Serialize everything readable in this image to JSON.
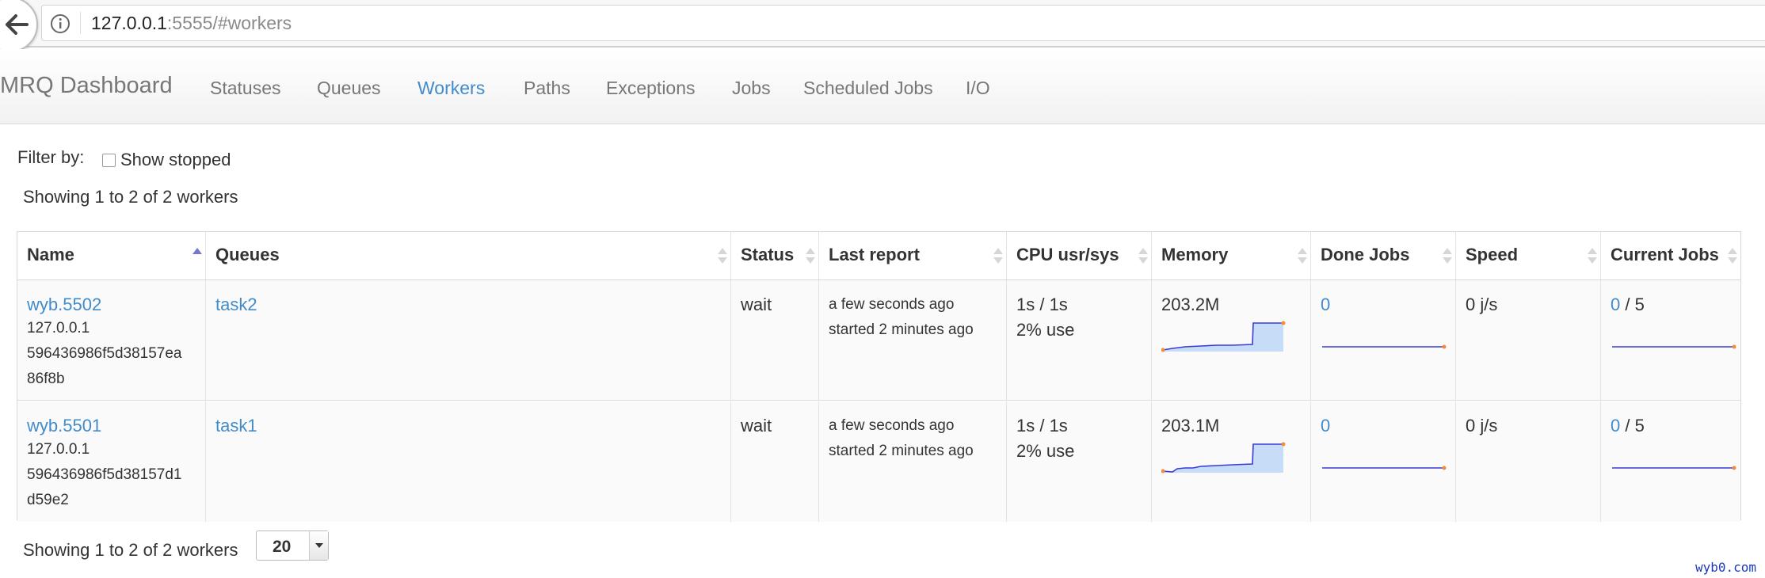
{
  "browser": {
    "url_host": "127.0.0.1",
    "url_rest": ":5555/#workers"
  },
  "navbar": {
    "brand": "MRQ Dashboard",
    "items": [
      "Statuses",
      "Queues",
      "Workers",
      "Paths",
      "Exceptions",
      "Jobs",
      "Scheduled Jobs",
      "I/O"
    ],
    "active": "Workers"
  },
  "filter": {
    "label": "Filter by:",
    "show_stopped_label": "Show stopped",
    "show_stopped_checked": false
  },
  "info_text": "Showing 1 to 2 of 2 workers",
  "table": {
    "columns": [
      "Name",
      "Queues",
      "Status",
      "Last report",
      "CPU usr/sys",
      "Memory",
      "Done Jobs",
      "Speed",
      "Current Jobs"
    ],
    "rows": [
      {
        "name": "wyb.5502",
        "ip": "127.0.0.1",
        "id_line1": "596436986f5d38157ea",
        "id_line2": "86f8b",
        "queue": "task2",
        "status": "wait",
        "last_report": "a few seconds ago",
        "started": "started 2 minutes ago",
        "cpu": "1s / 1s",
        "cpu_use": "2% use",
        "memory": "203.2M",
        "done_jobs": "0",
        "speed": "0 j/s",
        "current_jobs": "0",
        "current_jobs_max": "/ 5"
      },
      {
        "name": "wyb.5501",
        "ip": "127.0.0.1",
        "id_line1": "596436986f5d38157d1",
        "id_line2": "d59e2",
        "queue": "task1",
        "status": "wait",
        "last_report": "a few seconds ago",
        "started": "started 2 minutes ago",
        "cpu": "1s / 1s",
        "cpu_use": "2% use",
        "memory": "203.1M",
        "done_jobs": "0",
        "speed": "0 j/s",
        "current_jobs": "0",
        "current_jobs_max": "/ 5"
      }
    ]
  },
  "footer": {
    "info_text": "Showing 1 to 2 of 2 workers",
    "page_size": "20"
  },
  "watermark": "wyb0.com",
  "colors": {
    "link": "#428bca",
    "spark_line": "#3b3bd6",
    "spark_fill": "#c7dcf7",
    "spark_dot": "#f58a3c"
  }
}
